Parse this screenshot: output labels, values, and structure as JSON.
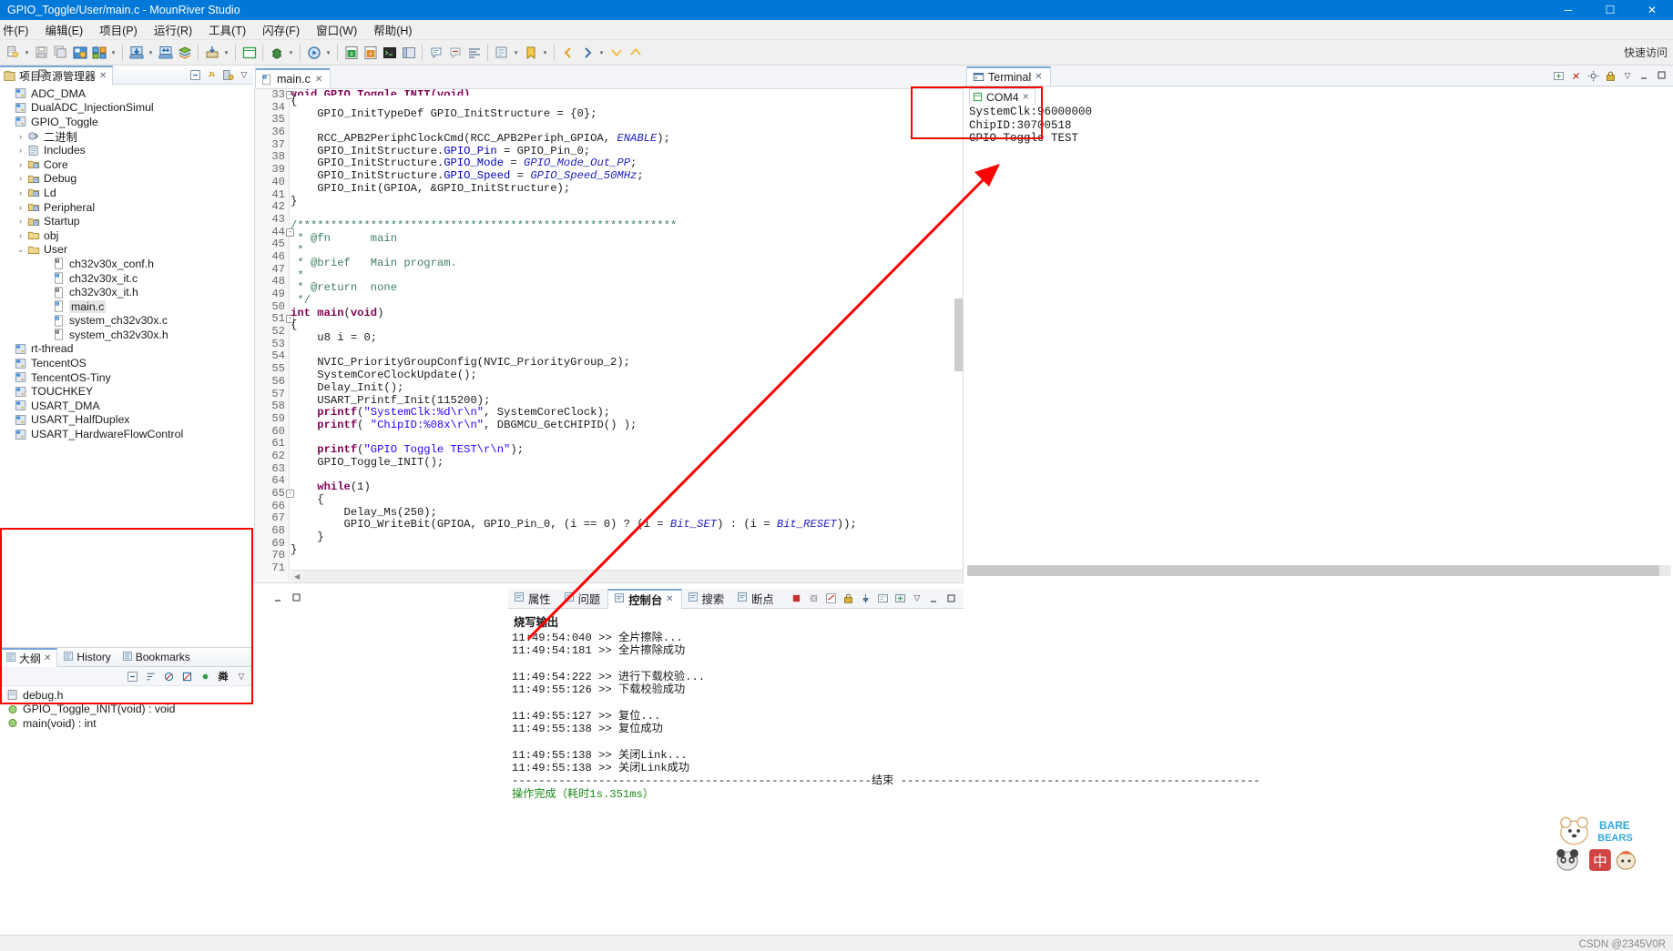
{
  "window": {
    "title": "GPIO_Toggle/User/main.c - MounRiver Studio",
    "minimize": "─",
    "maximize": "☐",
    "close": "✕"
  },
  "menubar": {
    "items": [
      {
        "label": "件(F)",
        "name": "menu-file"
      },
      {
        "label": "编辑(E)",
        "name": "menu-edit"
      },
      {
        "label": "项目(P)",
        "name": "menu-project"
      },
      {
        "label": "运行(R)",
        "name": "menu-run"
      },
      {
        "label": "工具(T)",
        "name": "menu-tools"
      },
      {
        "label": "闪存(F)",
        "name": "menu-flash"
      },
      {
        "label": "窗口(W)",
        "name": "menu-window"
      },
      {
        "label": "帮助(H)",
        "name": "menu-help"
      }
    ]
  },
  "toolbar": {
    "quick_access": "快速访问"
  },
  "project_explorer": {
    "title": "项目资源管理器",
    "tree": [
      {
        "label": "ADC_DMA",
        "indent": 0,
        "twisty": "",
        "icon": "project-icon"
      },
      {
        "label": "DualADC_InjectionSimul",
        "indent": 0,
        "twisty": "",
        "icon": "project-icon"
      },
      {
        "label": "GPIO_Toggle",
        "indent": 0,
        "twisty": "",
        "icon": "project-icon"
      },
      {
        "label": "二进制",
        "indent": 1,
        "twisty": "collapsed",
        "icon": "binary-icon"
      },
      {
        "label": "Includes",
        "indent": 1,
        "twisty": "collapsed",
        "icon": "includes-icon"
      },
      {
        "label": "Core",
        "indent": 1,
        "twisty": "collapsed",
        "icon": "source-folder-icon"
      },
      {
        "label": "Debug",
        "indent": 1,
        "twisty": "collapsed",
        "icon": "source-folder-icon"
      },
      {
        "label": "Ld",
        "indent": 1,
        "twisty": "collapsed",
        "icon": "source-folder-icon"
      },
      {
        "label": "Peripheral",
        "indent": 1,
        "twisty": "collapsed",
        "icon": "source-folder-icon"
      },
      {
        "label": "Startup",
        "indent": 1,
        "twisty": "collapsed",
        "icon": "source-folder-icon"
      },
      {
        "label": "obj",
        "indent": 1,
        "twisty": "collapsed",
        "icon": "folder-icon"
      },
      {
        "label": "User",
        "indent": 1,
        "twisty": "expanded",
        "icon": "folder-icon"
      },
      {
        "label": "ch32v30x_conf.h",
        "indent": 3,
        "twisty": "",
        "icon": "header-file-icon"
      },
      {
        "label": "ch32v30x_it.c",
        "indent": 3,
        "twisty": "",
        "icon": "c-file-icon"
      },
      {
        "label": "ch32v30x_it.h",
        "indent": 3,
        "twisty": "",
        "icon": "header-file-icon"
      },
      {
        "label": "main.c",
        "indent": 3,
        "twisty": "",
        "icon": "c-file-icon",
        "selected": true
      },
      {
        "label": "system_ch32v30x.c",
        "indent": 3,
        "twisty": "",
        "icon": "c-file-icon"
      },
      {
        "label": "system_ch32v30x.h",
        "indent": 3,
        "twisty": "",
        "icon": "header-file-icon"
      },
      {
        "label": "rt-thread",
        "indent": 0,
        "twisty": "",
        "icon": "project-icon"
      },
      {
        "label": "TencentOS",
        "indent": 0,
        "twisty": "",
        "icon": "project-icon"
      },
      {
        "label": "TencentOS-Tiny",
        "indent": 0,
        "twisty": "",
        "icon": "project-icon"
      },
      {
        "label": "TOUCHKEY",
        "indent": 0,
        "twisty": "",
        "icon": "project-icon"
      },
      {
        "label": "USART_DMA",
        "indent": 0,
        "twisty": "",
        "icon": "project-icon"
      },
      {
        "label": "USART_HalfDuplex",
        "indent": 0,
        "twisty": "",
        "icon": "project-icon"
      },
      {
        "label": "USART_HardwareFlowControl",
        "indent": 0,
        "twisty": "",
        "icon": "project-icon"
      }
    ]
  },
  "outline": {
    "tabs": [
      {
        "label": "大纲",
        "active": true,
        "name": "tab-outline"
      },
      {
        "label": "History",
        "active": false,
        "name": "tab-history"
      },
      {
        "label": "Bookmarks",
        "active": false,
        "name": "tab-bookmarks"
      }
    ],
    "items": [
      {
        "label": "debug.h",
        "icon": "include-icon"
      },
      {
        "label": "GPIO_Toggle_INIT(void) : void",
        "icon": "method-icon"
      },
      {
        "label": "main(void) : int",
        "icon": "method-icon"
      }
    ]
  },
  "editor": {
    "tab_label": "main.c",
    "first_line": 33,
    "lines": [
      {
        "n": 33,
        "fold": "-",
        "segs": [
          {
            "t": "void GPIO_Toggle_INIT(void)",
            "c": "kw"
          }
        ],
        "clipped": true
      },
      {
        "n": 34,
        "segs": [
          {
            "t": "{",
            "c": ""
          }
        ]
      },
      {
        "n": 35,
        "segs": [
          {
            "t": "    GPIO_InitTypeDef GPIO_InitStructure = {0};",
            "c": ""
          }
        ]
      },
      {
        "n": 36,
        "segs": []
      },
      {
        "n": 37,
        "segs": [
          {
            "t": "    RCC_APB2PeriphClockCmd(RCC_APB2Periph_GPIOA, ",
            "c": ""
          },
          {
            "t": "ENABLE",
            "c": "ital"
          },
          {
            "t": ");",
            "c": ""
          }
        ]
      },
      {
        "n": 38,
        "segs": [
          {
            "t": "    GPIO_InitStructure.",
            "c": ""
          },
          {
            "t": "GPIO_Pin",
            "c": "fld"
          },
          {
            "t": " = GPIO_Pin_0;",
            "c": ""
          }
        ]
      },
      {
        "n": 39,
        "segs": [
          {
            "t": "    GPIO_InitStructure.",
            "c": ""
          },
          {
            "t": "GPIO_Mode",
            "c": "fld"
          },
          {
            "t": " = ",
            "c": ""
          },
          {
            "t": "GPIO_Mode_Out_PP",
            "c": "ital"
          },
          {
            "t": ";",
            "c": ""
          }
        ]
      },
      {
        "n": 40,
        "segs": [
          {
            "t": "    GPIO_InitStructure.",
            "c": ""
          },
          {
            "t": "GPIO_Speed",
            "c": "fld"
          },
          {
            "t": " = ",
            "c": ""
          },
          {
            "t": "GPIO_Speed_50MHz",
            "c": "ital"
          },
          {
            "t": ";",
            "c": ""
          }
        ]
      },
      {
        "n": 41,
        "segs": [
          {
            "t": "    GPIO_Init(GPIOA, &GPIO_InitStructure);",
            "c": ""
          }
        ]
      },
      {
        "n": 42,
        "segs": [
          {
            "t": "}",
            "c": ""
          }
        ]
      },
      {
        "n": 43,
        "segs": []
      },
      {
        "n": 44,
        "fold": "-",
        "segs": [
          {
            "t": "/*********************************************************",
            "c": "cm"
          }
        ]
      },
      {
        "n": 45,
        "segs": [
          {
            "t": " * @fn      main",
            "c": "cm"
          }
        ]
      },
      {
        "n": 46,
        "segs": [
          {
            "t": " *",
            "c": "cm"
          }
        ]
      },
      {
        "n": 47,
        "segs": [
          {
            "t": " * @brief   Main program.",
            "c": "cm"
          }
        ]
      },
      {
        "n": 48,
        "segs": [
          {
            "t": " *",
            "c": "cm"
          }
        ]
      },
      {
        "n": 49,
        "segs": [
          {
            "t": " * @return  none",
            "c": "cm"
          }
        ]
      },
      {
        "n": 50,
        "segs": [
          {
            "t": " */",
            "c": "cm"
          }
        ]
      },
      {
        "n": 51,
        "fold": "-",
        "segs": [
          {
            "t": "int main",
            "c": "kw"
          },
          {
            "t": "(",
            "c": ""
          },
          {
            "t": "void",
            "c": "kw"
          },
          {
            "t": ")",
            "c": ""
          }
        ]
      },
      {
        "n": 52,
        "segs": [
          {
            "t": "{",
            "c": ""
          }
        ]
      },
      {
        "n": 53,
        "segs": [
          {
            "t": "    u8 i = 0;",
            "c": ""
          }
        ]
      },
      {
        "n": 54,
        "segs": []
      },
      {
        "n": 55,
        "segs": [
          {
            "t": "    NVIC_PriorityGroupConfig(NVIC_PriorityGroup_2);",
            "c": ""
          }
        ]
      },
      {
        "n": 56,
        "segs": [
          {
            "t": "    SystemCoreClockUpdate();",
            "c": ""
          }
        ]
      },
      {
        "n": 57,
        "segs": [
          {
            "t": "    Delay_Init();",
            "c": ""
          }
        ]
      },
      {
        "n": 58,
        "segs": [
          {
            "t": "    USART_Printf_Init(115200);",
            "c": ""
          }
        ]
      },
      {
        "n": 59,
        "segs": [
          {
            "t": "    printf",
            "c": "kw"
          },
          {
            "t": "(",
            "c": ""
          },
          {
            "t": "\"SystemClk:%d\\r\\n\"",
            "c": "st"
          },
          {
            "t": ", SystemCoreClock);",
            "c": ""
          }
        ]
      },
      {
        "n": 60,
        "segs": [
          {
            "t": "    printf",
            "c": "kw"
          },
          {
            "t": "( ",
            "c": ""
          },
          {
            "t": "\"ChipID:%08x\\r\\n\"",
            "c": "st"
          },
          {
            "t": ", DBGMCU_GetCHIPID() );",
            "c": ""
          }
        ]
      },
      {
        "n": 61,
        "segs": []
      },
      {
        "n": 62,
        "segs": [
          {
            "t": "    printf",
            "c": "kw"
          },
          {
            "t": "(",
            "c": ""
          },
          {
            "t": "\"GPIO Toggle TEST\\r\\n\"",
            "c": "st"
          },
          {
            "t": ");",
            "c": ""
          }
        ]
      },
      {
        "n": 63,
        "segs": [
          {
            "t": "    GPIO_Toggle_INIT();",
            "c": ""
          }
        ]
      },
      {
        "n": 64,
        "segs": []
      },
      {
        "n": 65,
        "fold": "-",
        "segs": [
          {
            "t": "    while",
            "c": "kw"
          },
          {
            "t": "(1)",
            "c": ""
          }
        ]
      },
      {
        "n": 66,
        "segs": [
          {
            "t": "    {",
            "c": ""
          }
        ]
      },
      {
        "n": 67,
        "segs": [
          {
            "t": "        Delay_Ms(250);",
            "c": ""
          }
        ]
      },
      {
        "n": 68,
        "segs": [
          {
            "t": "        GPIO_WriteBit(GPIOA, GPIO_Pin_0, (i == 0) ? (i = ",
            "c": ""
          },
          {
            "t": "Bit_SET",
            "c": "ital"
          },
          {
            "t": ") : (i = ",
            "c": ""
          },
          {
            "t": "Bit_RESET",
            "c": "ital"
          },
          {
            "t": "));",
            "c": ""
          }
        ]
      },
      {
        "n": 69,
        "segs": [
          {
            "t": "    }",
            "c": ""
          }
        ]
      },
      {
        "n": 70,
        "segs": [
          {
            "t": "}",
            "c": ""
          }
        ]
      },
      {
        "n": 71,
        "segs": []
      }
    ]
  },
  "console": {
    "tabs": [
      {
        "label": "属性",
        "active": false,
        "name": "tab-properties",
        "icon": "properties-icon"
      },
      {
        "label": "问题",
        "active": false,
        "name": "tab-problems",
        "icon": "problems-icon"
      },
      {
        "label": "控制台",
        "active": true,
        "name": "tab-console",
        "icon": "console-icon"
      },
      {
        "label": "搜索",
        "active": false,
        "name": "tab-search",
        "icon": "search-icon"
      },
      {
        "label": "断点",
        "active": false,
        "name": "tab-breakpoints",
        "icon": "breakpoint-icon"
      }
    ],
    "header": "烧写输出",
    "lines": [
      {
        "text": "11:49:54:040 >> 全片擦除...",
        "ok": false
      },
      {
        "text": "11:49:54:181 >> 全片擦除成功",
        "ok": false
      },
      {
        "text": "",
        "ok": false
      },
      {
        "text": "11:49:54:222 >> 进行下载校验...",
        "ok": false
      },
      {
        "text": "11:49:55:126 >> 下载校验成功",
        "ok": false
      },
      {
        "text": "",
        "ok": false
      },
      {
        "text": "11:49:55:127 >> 复位...",
        "ok": false
      },
      {
        "text": "11:49:55:138 >> 复位成功",
        "ok": false
      },
      {
        "text": "",
        "ok": false
      },
      {
        "text": "11:49:55:138 >> 关闭Link...",
        "ok": false
      },
      {
        "text": "11:49:55:138 >> 关闭Link成功",
        "ok": false
      },
      {
        "text": "------------------------------------------------------结束 ------------------------------------------------------",
        "ok": false
      },
      {
        "text": "操作完成（耗时1s.351ms）",
        "ok": true
      }
    ]
  },
  "terminal": {
    "tab_label": "Terminal",
    "sub_tab_label": "COM4",
    "lines": [
      "SystemClk:96000000",
      "ChipID:30700518",
      "GPIO Toggle TEST"
    ]
  },
  "statusbar": {
    "watermark": "CSDN @2345V0R"
  },
  "annotations": {
    "accent_red": "#ff0000"
  }
}
